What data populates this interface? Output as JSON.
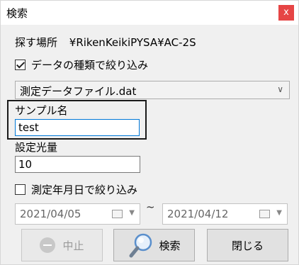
{
  "window": {
    "title": "検索",
    "close_glyph": "x"
  },
  "search_location": {
    "label": "探す場所",
    "path": "¥RikenKeikiPYSA¥AC-2S"
  },
  "filter_type": {
    "label": "データの種類で絞り込み",
    "checked": true
  },
  "data_type_select": {
    "value": "測定データファイル.dat",
    "arrow": "∨"
  },
  "sample_name": {
    "label": "サンプル名",
    "value": "test"
  },
  "light_amount": {
    "label": "設定光量",
    "value": "10"
  },
  "filter_date": {
    "label": "測定年月日で絞り込み",
    "checked": false
  },
  "date_range": {
    "from": "2021/04/05",
    "separator": "~",
    "to": "2021/04/12"
  },
  "buttons": {
    "stop": "中止",
    "search": "検索",
    "close": "閉じる"
  },
  "icons": {
    "close": "close-icon",
    "calendar": "calendar-icon",
    "search": "magnifier-icon",
    "stop": "stop-icon"
  },
  "colors": {
    "close_button": "#e64545",
    "focus_border": "#0078d7",
    "disabled_text": "#9a9a9a"
  }
}
